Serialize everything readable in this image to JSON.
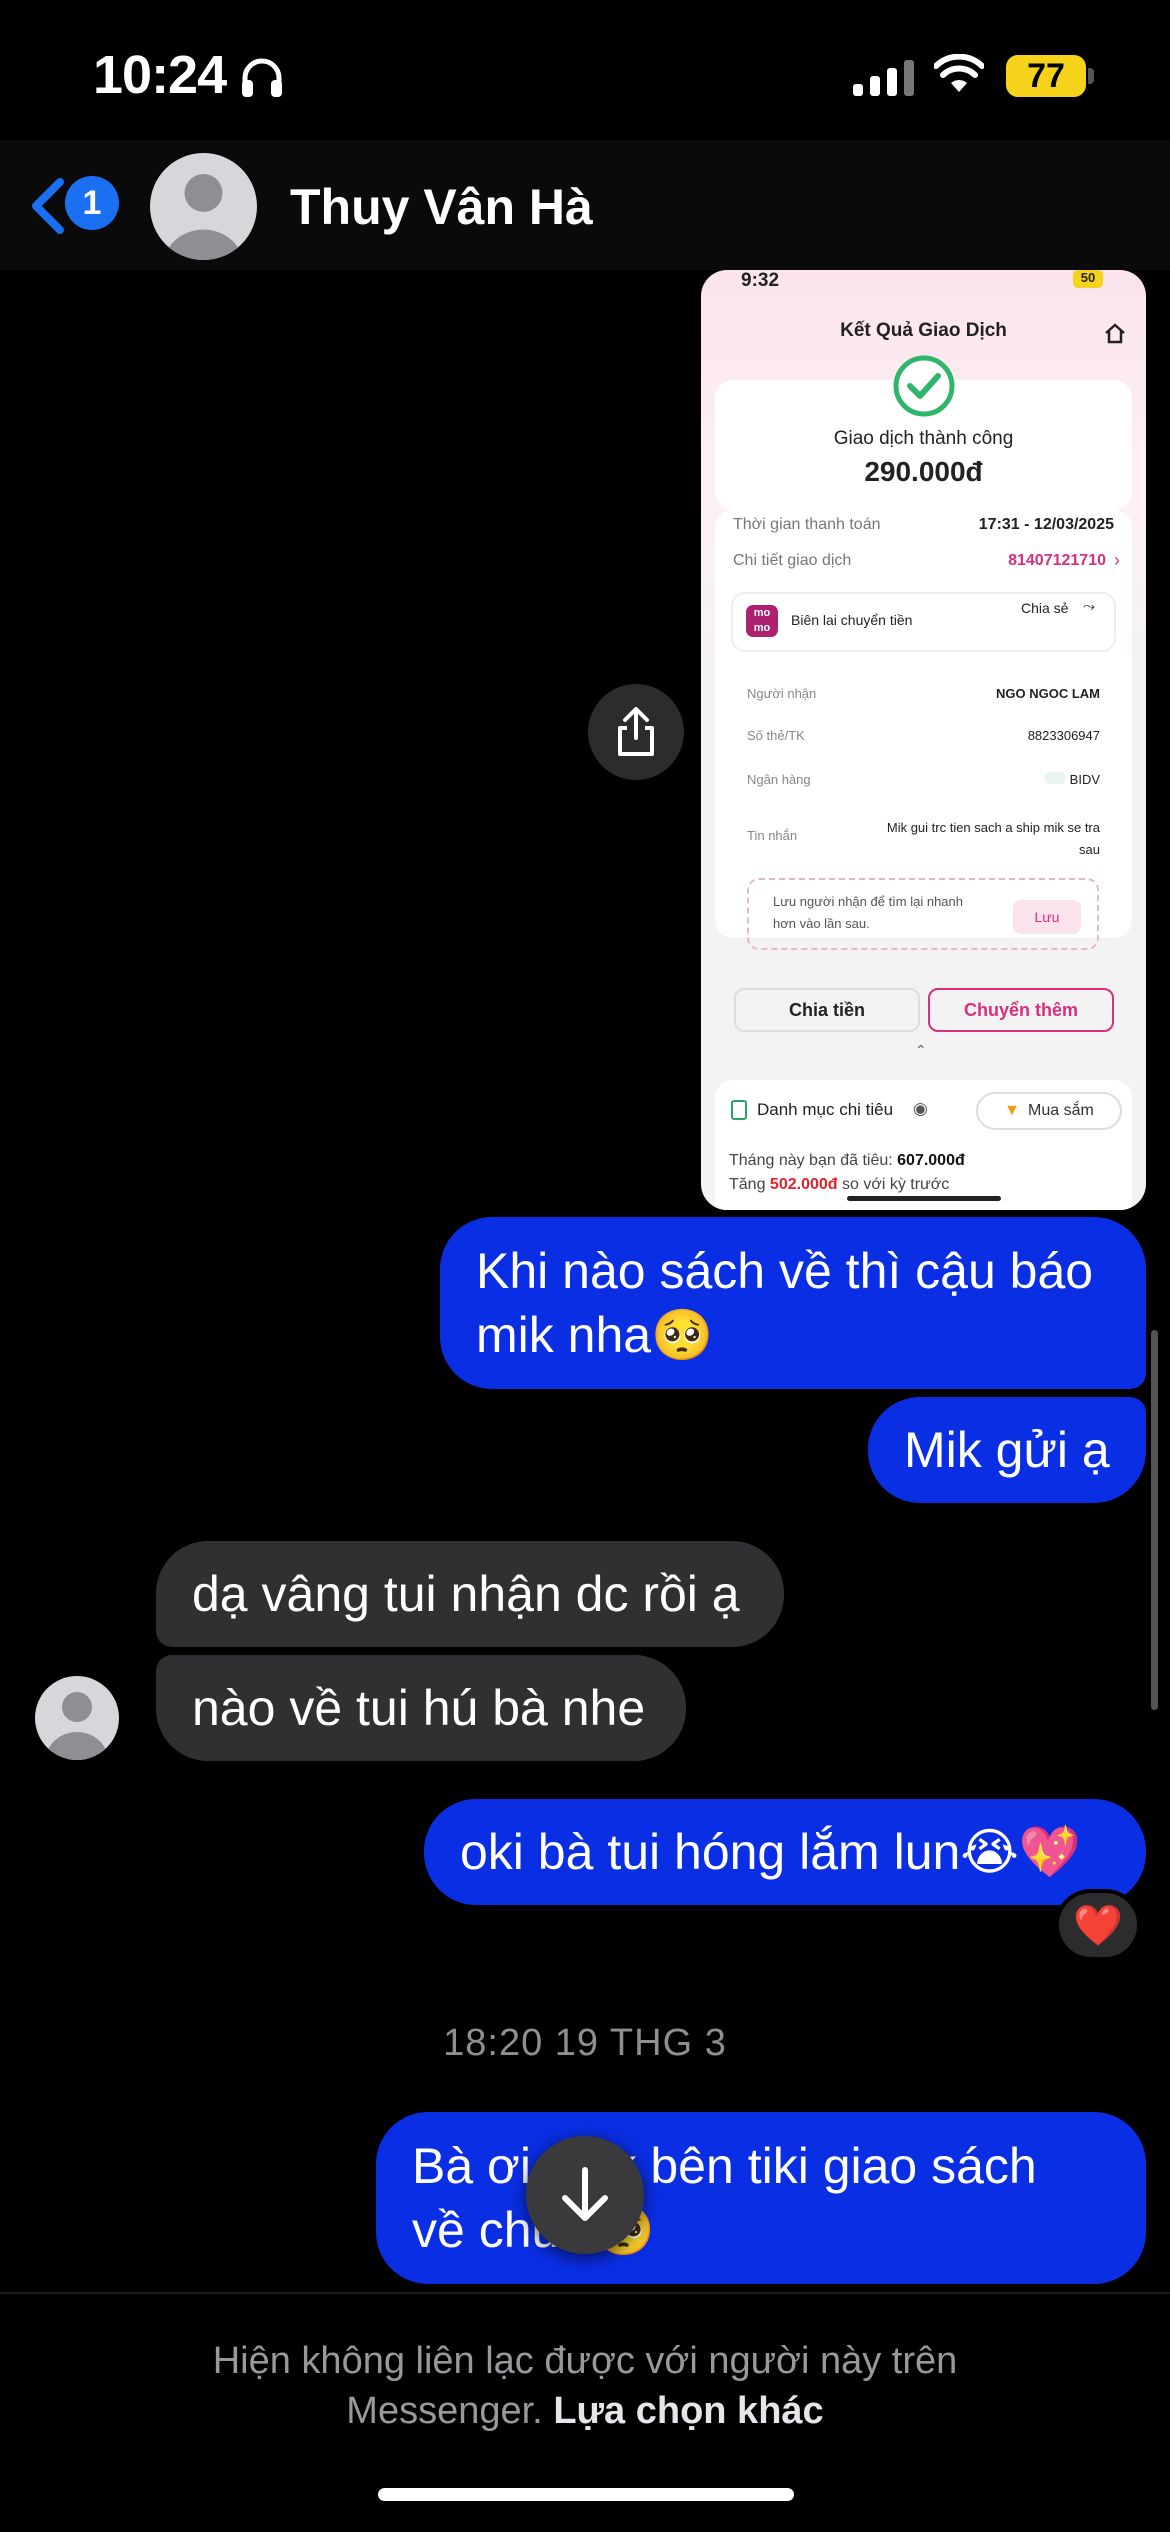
{
  "status_bar": {
    "time": "10:24",
    "headphone_icon": "headphones-icon",
    "battery_level": "77",
    "battery_color": "#f5d31a"
  },
  "header": {
    "back_badge": "1",
    "contact_name": "Thuy Vân Hà"
  },
  "attachment": {
    "status_time": "9:32",
    "status_battery": "50",
    "title": "Kết Quả Giao Dịch",
    "success_text": "Giao dịch thành công",
    "amount": "290.000đ",
    "time_label": "Thời gian thanh toán",
    "time_value": "17:31 - 12/03/2025",
    "detail_label": "Chi tiết giao dịch",
    "detail_value": "81407121710",
    "logo_text": "mo mo",
    "receipt_label": "Biên lai chuyển tiền",
    "share_label": "Chia sẻ",
    "recipient_label": "Người nhận",
    "recipient_value": "NGO NGOC LAM",
    "account_label": "Số thẻ/TK",
    "account_value": "8823306947",
    "bank_label": "Ngân hàng",
    "bank_value": "BIDV",
    "message_label": "Tin nhắn",
    "message_value_1": "Mik gui trc tien sach a ship mik se tra",
    "message_value_2": "sau",
    "save_hint_1": "Lưu người nhận để tìm lại nhanh",
    "save_hint_2": "hơn vào lần sau.",
    "save_button": "Lưu",
    "split_button": "Chia tiền",
    "transfer_more_button": "Chuyển thêm",
    "category_label": "Danh mục chi tiêu",
    "category_value": "Mua sắm",
    "spent_text": "Tháng này bạn đã tiêu:",
    "spent_value": "607.000đ",
    "increase_text": "Tăng",
    "increase_value": "502.000đ",
    "increase_suffix": "so với kỳ trước",
    "accent_color": "#d6307c"
  },
  "messages": [
    {
      "side": "out",
      "lines": [
        "Khi nào sách về thì cậu báo",
        "mik nha🥺"
      ]
    },
    {
      "side": "out",
      "lines": [
        "Mik gửi ạ"
      ]
    },
    {
      "side": "in",
      "lines": [
        "dạ vâng tui nhận dc rồi ạ"
      ]
    },
    {
      "side": "in",
      "lines": [
        "nào về tui hú bà nhe"
      ]
    },
    {
      "side": "out",
      "lines": [
        "oki bà tui hóng lắm lun😭💖"
      ],
      "reaction": "❤️"
    },
    {
      "side": "out",
      "lines": [
        "Bà ơi, mik bên tiki giao sách",
        "về chưa🥺"
      ]
    }
  ],
  "timestamp": "18:20 19 THG 3",
  "colors": {
    "outgoing_bubble": "#0a2ee3",
    "incoming_bubble": "#303033",
    "badge_blue": "#1b6ff2"
  },
  "footer": {
    "notice": "Hiện không liên lạc được với người này trên",
    "notice_2": "Messenger.",
    "link": "Lựa chọn khác"
  }
}
